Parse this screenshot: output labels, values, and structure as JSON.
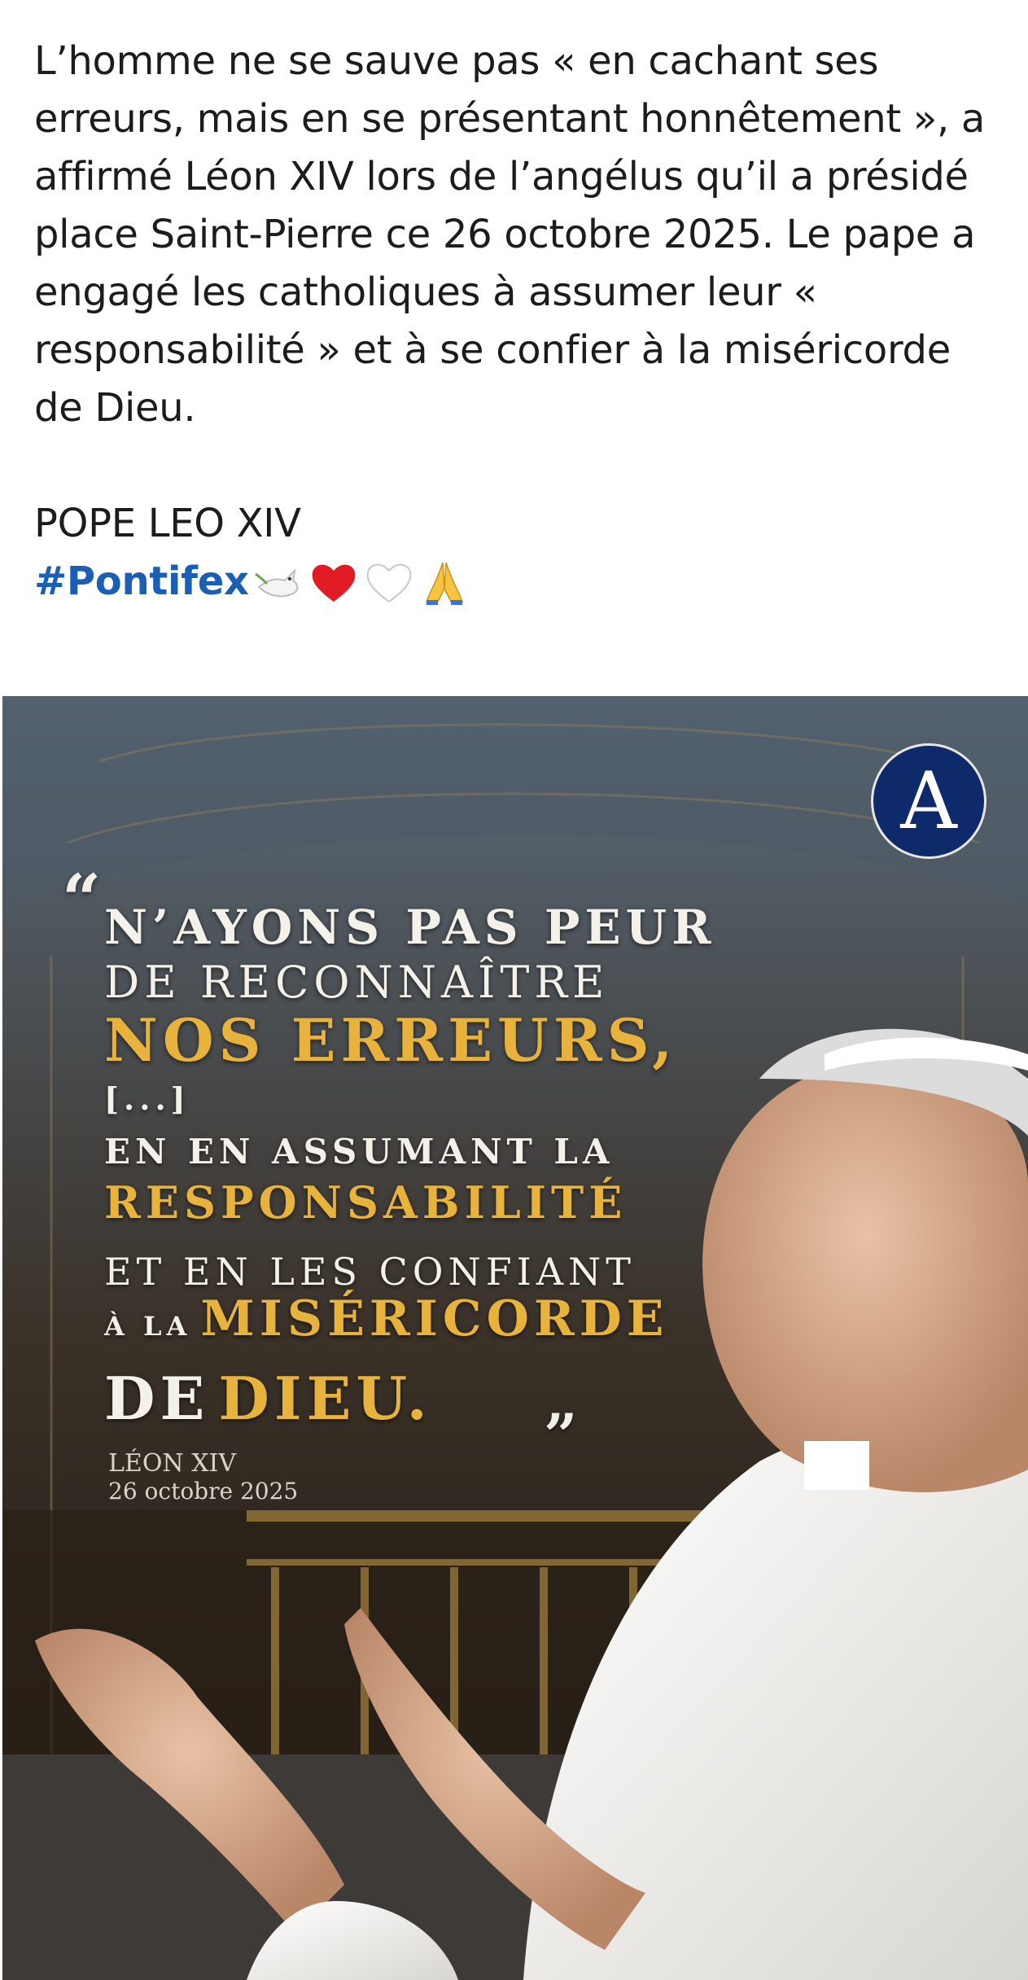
{
  "post": {
    "paragraph": "L’homme ne se sauve pas « en cachant ses erreurs, mais en se présentant honnêtement », a affirmé Léon XIV lors de l’angélus qu’il a présidé place Saint-Pierre ce 26 octobre 2025. Le pape a engagé les catholiques à assumer leur « responsabilité » et à se confier à la miséricorde de Dieu.",
    "author_line": "POPE LEO XIV",
    "hashtag": "#Pontifex",
    "emojis": [
      "dove-icon",
      "red-heart-icon",
      "white-heart-icon",
      "praying-hands-icon"
    ]
  },
  "card": {
    "logo_letter": "A",
    "open_quote": "“",
    "close_quote": "”",
    "line1": "N’AYONS PAS PEUR",
    "line2": "DE RECONNAÎTRE",
    "line3": "NOS ERREURS,",
    "line4": "[...]",
    "line5": "EN EN ASSUMANT LA",
    "line6": "RESPONSABILITÉ",
    "line7": "ET EN LES CONFIANT",
    "line8_small": "À LA",
    "line8_big": "MISÉRICORDE",
    "line9_white": "DE",
    "line9_gold": "DIEU.",
    "sig_name": "LÉON XIV",
    "sig_date": "26 octobre 2025",
    "colors": {
      "gold": "#e8b33d",
      "white_text": "#f4f1ea",
      "logo_bg": "#0e2a6b",
      "hashtag": "#1a5fb4"
    }
  }
}
